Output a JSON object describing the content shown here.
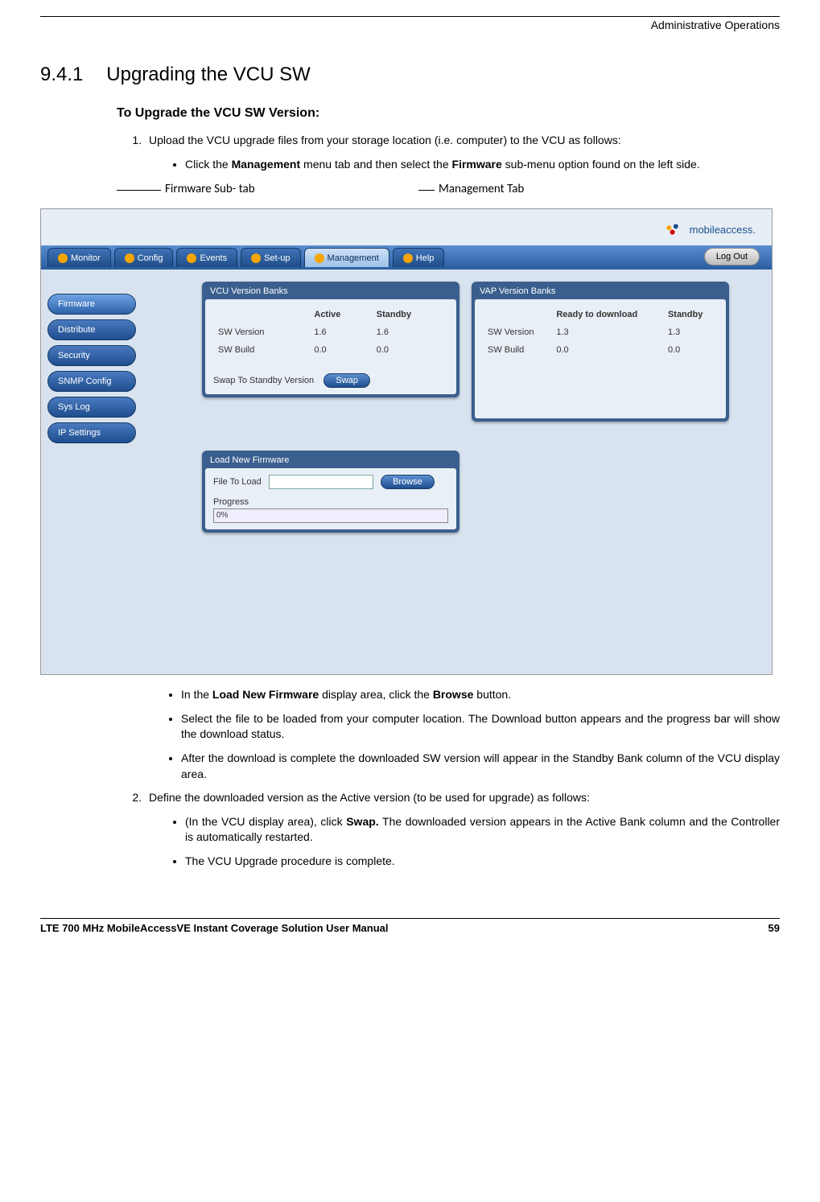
{
  "header": {
    "right": "Administrative Operations"
  },
  "section": {
    "number": "9.4.1",
    "title": "Upgrading the VCU SW"
  },
  "subhead": "To Upgrade the VCU SW Version:",
  "list": {
    "item1_pre": "Upload the VCU upgrade files from your storage location (i.e. computer) to the VCU as follows:",
    "item1_a_pre": "Click the ",
    "item1_a_b1": "Management",
    "item1_a_mid": " menu tab and then select the ",
    "item1_a_b2": "Firmware",
    "item1_a_post": " sub-menu option found on the left side.",
    "item1_b_pre": "In the ",
    "item1_b_b1": "Load New Firmware",
    "item1_b_mid": " display area, click the ",
    "item1_b_b2": "Browse",
    "item1_b_post": " button.",
    "item1_c": "Select the file to be loaded from your computer location. The Download button appears and the progress bar will show the download status.",
    "item1_d": "After the download is complete the downloaded SW version will appear in the Standby Bank column of the VCU display area.",
    "item2": "Define the downloaded version as the Active version (to be used for upgrade) as follows:",
    "item2_a_pre": "(In the VCU display area), click ",
    "item2_a_b1": "Swap.",
    "item2_a_post": " The downloaded version appears in the Active Bank column and the Controller is automatically restarted.",
    "item2_b": "The VCU Upgrade procedure is complete."
  },
  "callouts": {
    "left": "Firmware Sub- tab",
    "right": "Management Tab"
  },
  "ui": {
    "logo": "mobileaccess.",
    "tabs": [
      "Monitor",
      "Config",
      "Events",
      "Set-up",
      "Management",
      "Help"
    ],
    "logout": "Log Out",
    "sidebar": [
      "Firmware",
      "Distribute",
      "Security",
      "SNMP Config",
      "Sys Log",
      "IP Settings"
    ],
    "vcu": {
      "title": "VCU Version Banks",
      "col1": "Active",
      "col2": "Standby",
      "row1": "SW Version",
      "v1a": "1.6",
      "v1b": "1.6",
      "row2": "SW Build",
      "v2a": "0.0",
      "v2b": "0.0",
      "swap_label": "Swap To Standby Version",
      "swap_btn": "Swap"
    },
    "vap": {
      "title": "VAP Version Banks",
      "col1": "Ready to download",
      "col2": "Standby",
      "row1": "SW Version",
      "v1a": "1.3",
      "v1b": "1.3",
      "row2": "SW Build",
      "v2a": "0.0",
      "v2b": "0.0"
    },
    "load": {
      "title": "Load New Firmware",
      "file_label": "File To Load",
      "browse": "Browse",
      "progress_label": "Progress",
      "progress_val": "0%"
    }
  },
  "footer": {
    "left": "LTE 700 MHz MobileAccessVE Instant Coverage Solution User Manual",
    "right": "59"
  }
}
